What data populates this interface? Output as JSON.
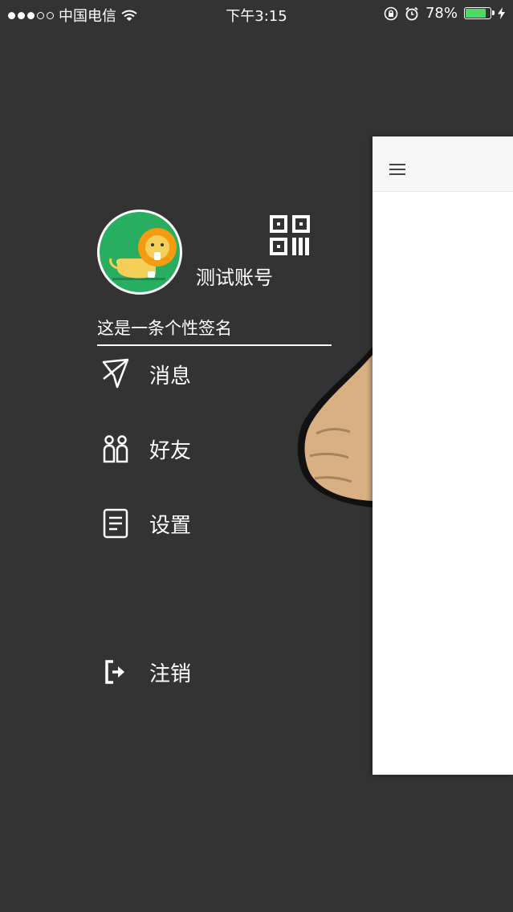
{
  "status_bar": {
    "carrier": "中国电信",
    "time": "下午3:15",
    "battery_percent": "78%",
    "battery_level": 0.78,
    "icons": [
      "signal-dots-icon",
      "wifi-icon",
      "orientation-lock-icon",
      "alarm-icon",
      "battery-icon",
      "charging-icon"
    ]
  },
  "profile": {
    "username": "测试账号",
    "signature": "这是一条个性签名",
    "avatar_icon": "lion-avatar",
    "qr_icon": "qr-code-icon"
  },
  "menu": [
    {
      "label": "消息",
      "icon": "message-icon"
    },
    {
      "label": "好友",
      "icon": "friends-icon"
    },
    {
      "label": "设置",
      "icon": "settings-icon"
    },
    {
      "label": "注销",
      "icon": "logout-icon"
    }
  ],
  "main_panel": {
    "menu_icon": "hamburger-menu-icon"
  },
  "colors": {
    "drawer_background": "#333333",
    "avatar_background": "#27ae60",
    "battery_fill": "#4cd964",
    "panel_background": "#ffffff",
    "navbar_background": "#f7f7f7"
  }
}
